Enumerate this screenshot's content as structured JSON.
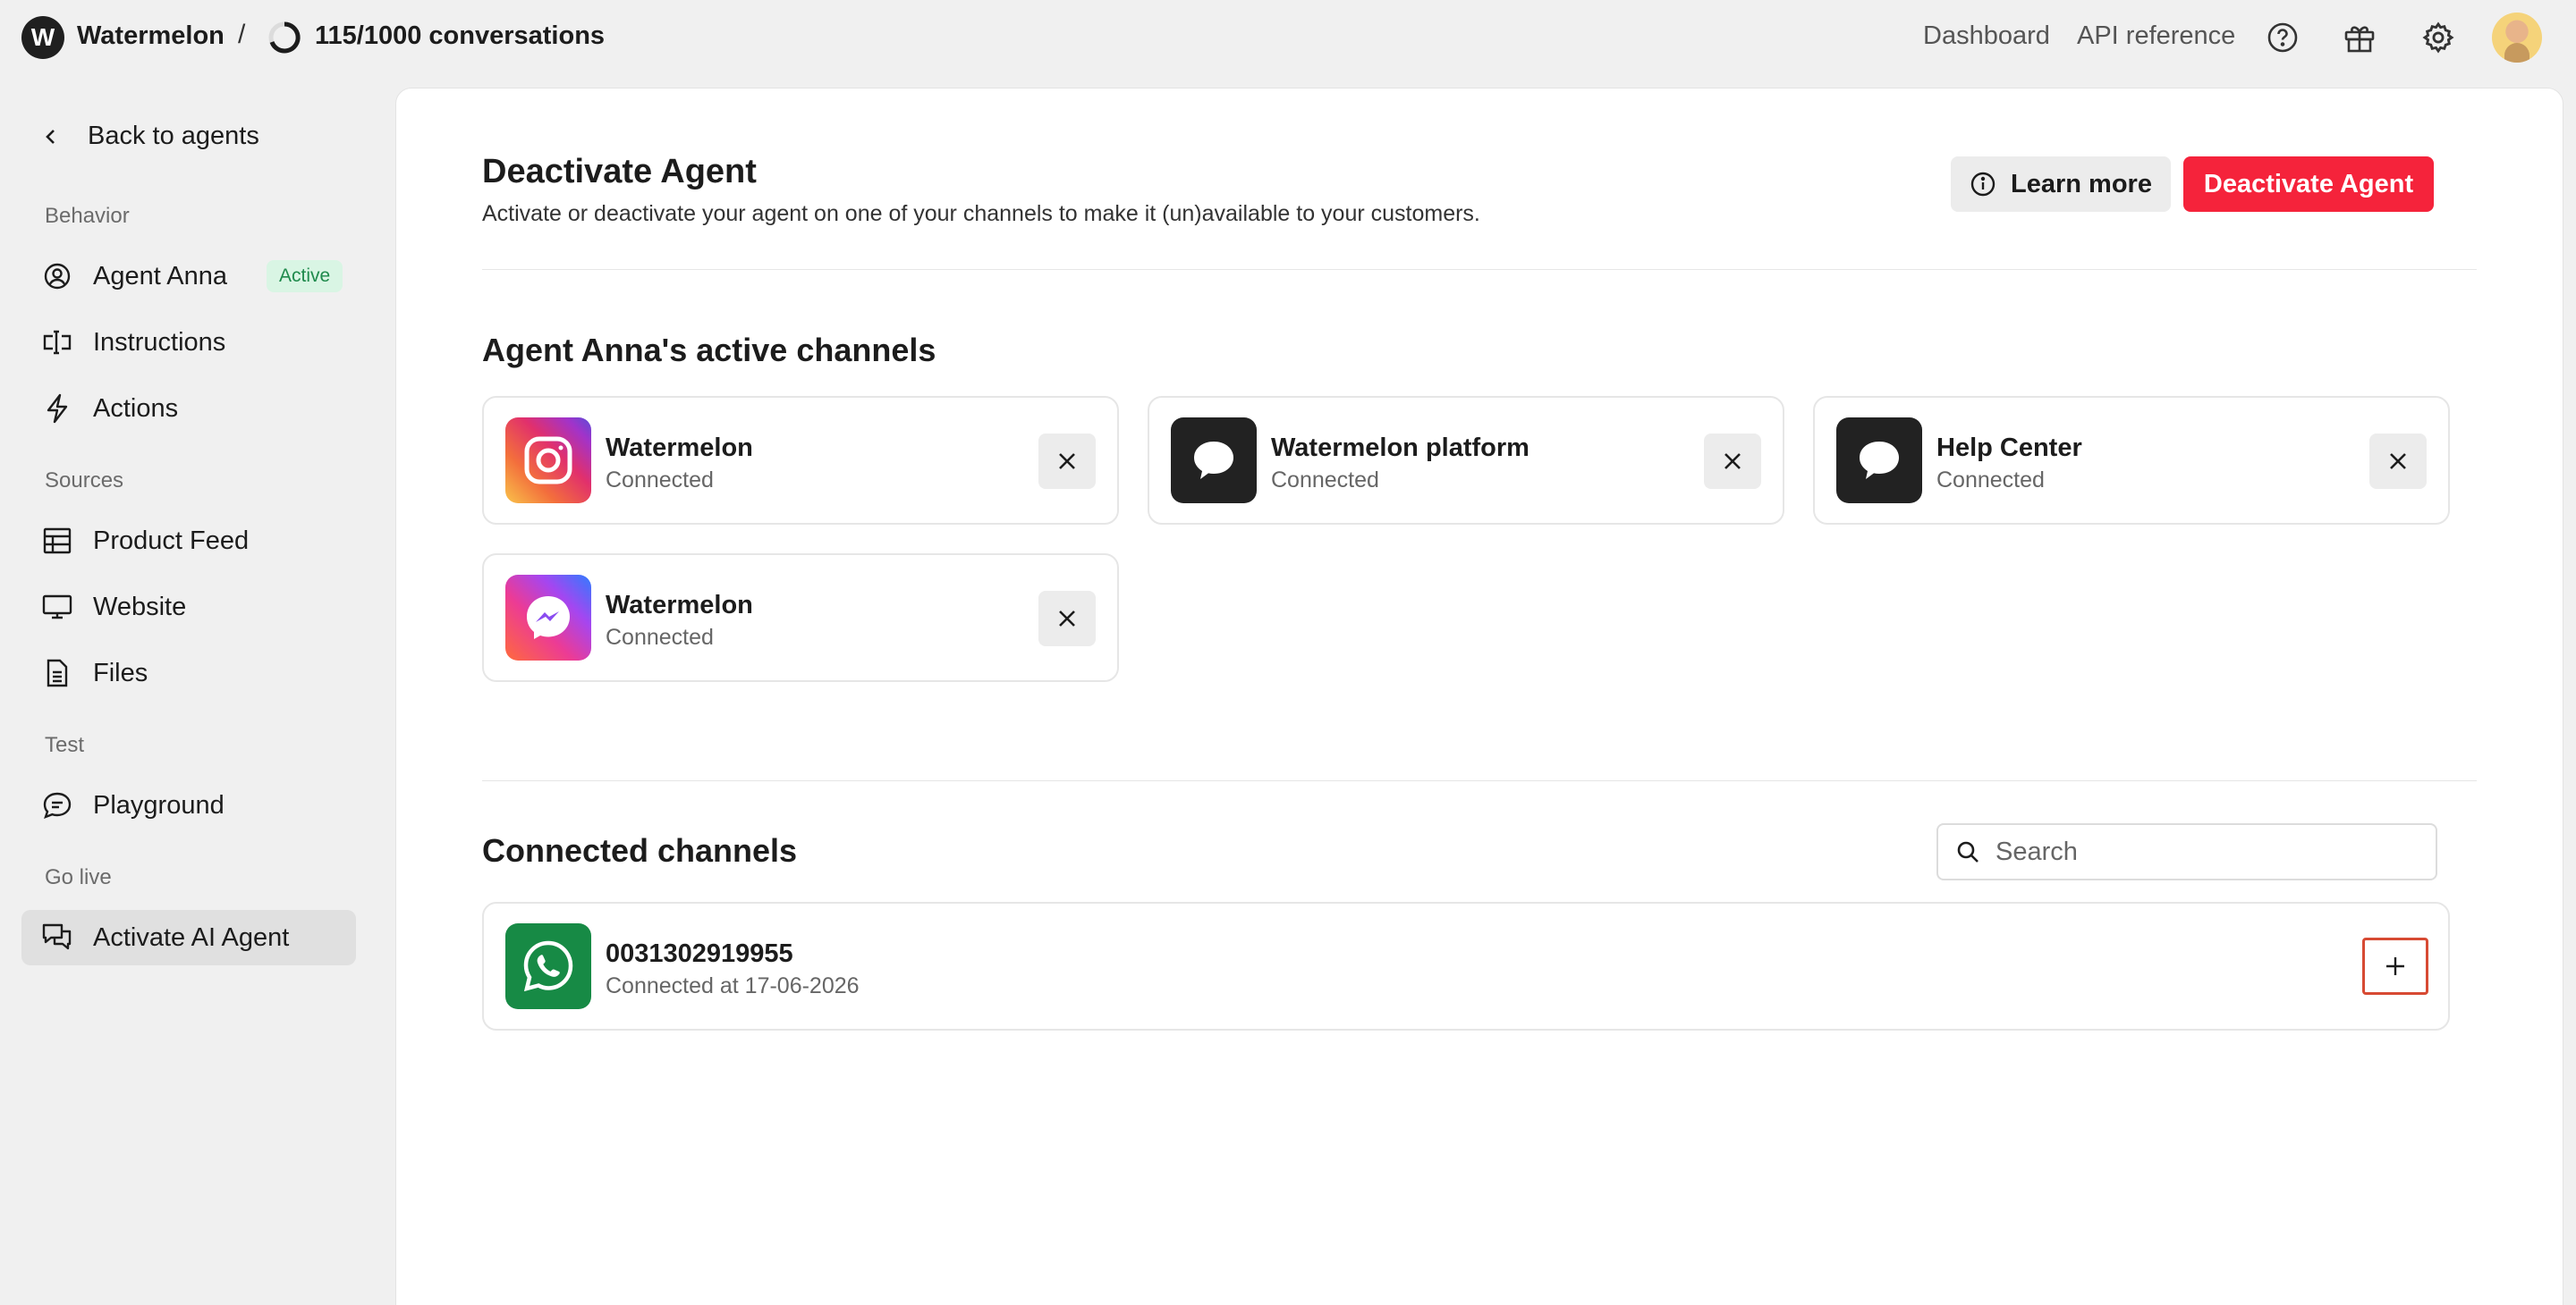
{
  "topbar": {
    "brand_letter": "W",
    "brand_name": "Watermelon",
    "separator": "/",
    "conversations": "115/1000 conversations",
    "links": {
      "dashboard": "Dashboard",
      "api_reference": "API reference"
    },
    "icons": [
      "help-icon",
      "gift-icon",
      "settings-icon"
    ]
  },
  "sidebar": {
    "back_label": "Back to agents",
    "sections": {
      "behavior": "Behavior",
      "sources": "Sources",
      "test": "Test",
      "go_live": "Go live"
    },
    "items": [
      {
        "label": "Agent Anna",
        "icon": "user-circle-icon",
        "badge": "Active"
      },
      {
        "label": "Instructions",
        "icon": "text-cursor-icon"
      },
      {
        "label": "Actions",
        "icon": "bolt-icon"
      },
      {
        "label": "Product Feed",
        "icon": "table-icon"
      },
      {
        "label": "Website",
        "icon": "monitor-icon"
      },
      {
        "label": "Files",
        "icon": "file-icon"
      },
      {
        "label": "Playground",
        "icon": "chat-icon"
      },
      {
        "label": "Activate AI Agent",
        "icon": "chats-icon",
        "selected": true
      }
    ]
  },
  "main": {
    "title": "Deactivate Agent",
    "subtitle": "Activate or deactivate your agent on one of your channels to make it (un)available to your customers.",
    "learn_more": "Learn more",
    "deactivate_button": "Deactivate Agent",
    "active_heading": "Agent Anna's active channels",
    "active_channels": [
      {
        "name": "Watermelon",
        "status": "Connected",
        "icon": "instagram-icon"
      },
      {
        "name": "Watermelon platform",
        "status": "Connected",
        "icon": "chat-bubble-icon"
      },
      {
        "name": "Help Center",
        "status": "Connected",
        "icon": "chat-bubble-icon"
      },
      {
        "name": "Watermelon",
        "status": "Connected",
        "icon": "messenger-icon"
      }
    ],
    "connected_heading": "Connected channels",
    "search_placeholder": "Search",
    "connected_channels": [
      {
        "name": "0031302919955",
        "status": "Connected at 17-06-2026",
        "icon": "whatsapp-icon"
      }
    ]
  },
  "colors": {
    "accent_red": "#f5233b",
    "badge_green_bg": "#d9f5e4",
    "badge_green_text": "#1f8a4c",
    "highlight_border": "#d74a33"
  }
}
